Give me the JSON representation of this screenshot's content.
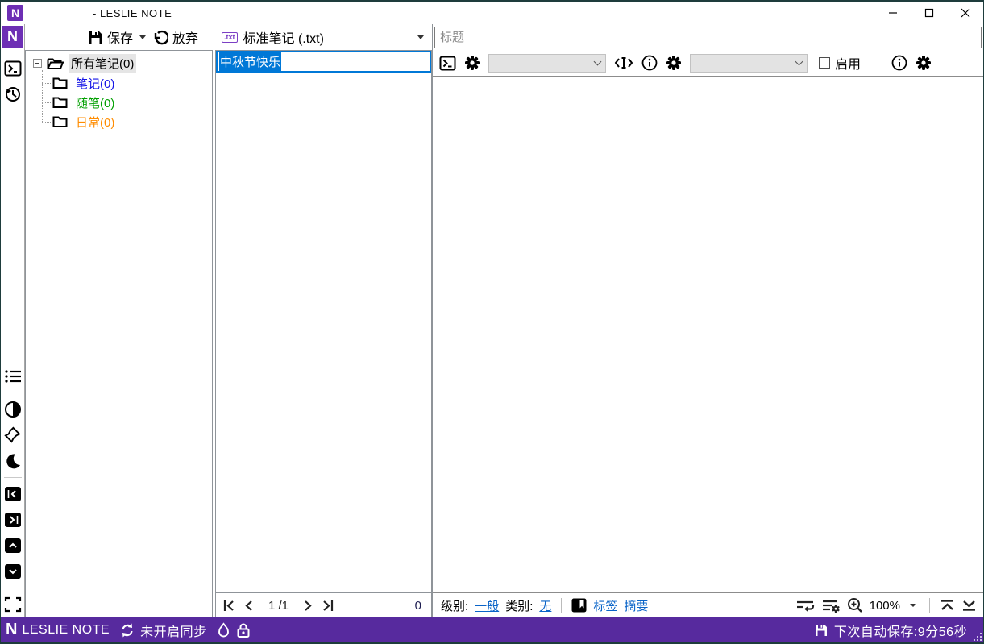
{
  "titlebar": {
    "title": "- LESLIE NOTE",
    "app_initial": "N"
  },
  "toolbar": {
    "save": "保存",
    "discard": "放弃"
  },
  "list_header": {
    "badge": ".txt",
    "type": "标准笔记 (.txt)"
  },
  "tree": {
    "items": [
      {
        "label": "所有笔记(0)",
        "color": "#000000",
        "selected": true
      },
      {
        "label": "笔记(0)",
        "color": "#1414e6"
      },
      {
        "label": "随笔(0)",
        "color": "#00a000"
      },
      {
        "label": "日常(0)",
        "color": "#ff8c00"
      }
    ]
  },
  "list": {
    "items": [
      {
        "title": "中秋节快乐"
      }
    ]
  },
  "pagination": {
    "page": "1",
    "of": "/1",
    "count": "0"
  },
  "editor": {
    "title_placeholder": "标题",
    "enable": "启用"
  },
  "bottombar": {
    "level_label": "级别:",
    "level": "一般",
    "category_label": "类别:",
    "category": "无",
    "tags": "标签",
    "summary": "摘要",
    "zoom": "100%"
  },
  "statusbar": {
    "app_initial": "N",
    "app": "LESLIE NOTE",
    "sync_status": "未开启同步",
    "autosave": "下次自动保存:9分56秒"
  },
  "colors": {
    "frame": "#1e3c3c",
    "accent_purple": "#572a9e",
    "logo_purple": "#6d2fb4",
    "selection_blue": "#0078d7",
    "link_blue": "#0a64c8",
    "tree_blue": "#1414e6",
    "tree_green": "#00a000",
    "tree_orange": "#ff8c00"
  }
}
